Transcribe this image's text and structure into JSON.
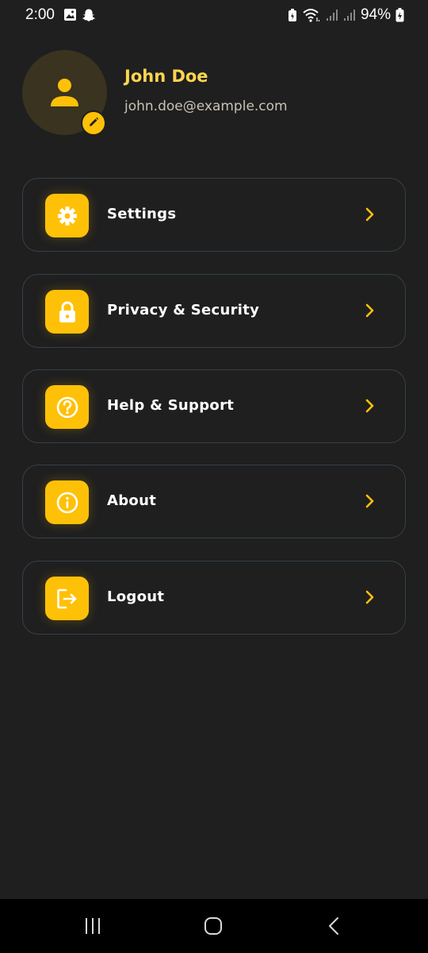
{
  "status_bar": {
    "time": "2:00",
    "battery": "94%",
    "icons": [
      "gallery-icon",
      "snapchat-icon",
      "battery-saver-icon",
      "wifi-icon",
      "signal-icon",
      "signal-icon",
      "battery-charging-icon"
    ]
  },
  "profile": {
    "name": "John Doe",
    "email": "john.doe@example.com",
    "avatar_icon": "person-icon",
    "edit_icon": "pencil-icon"
  },
  "menu": {
    "items": [
      {
        "label": "Settings",
        "icon": "gear-icon"
      },
      {
        "label": "Privacy & Security",
        "icon": "lock-icon"
      },
      {
        "label": "Help & Support",
        "icon": "help-circle-icon"
      },
      {
        "label": "About",
        "icon": "info-icon"
      },
      {
        "label": "Logout",
        "icon": "logout-icon"
      }
    ]
  },
  "nav_bar": {
    "buttons": [
      "recents-icon",
      "home-icon",
      "back-icon"
    ]
  },
  "colors": {
    "background": "#1f1f1f",
    "accent": "#ffc107",
    "name_text": "#ffd54f",
    "card_border": "#34404b"
  }
}
